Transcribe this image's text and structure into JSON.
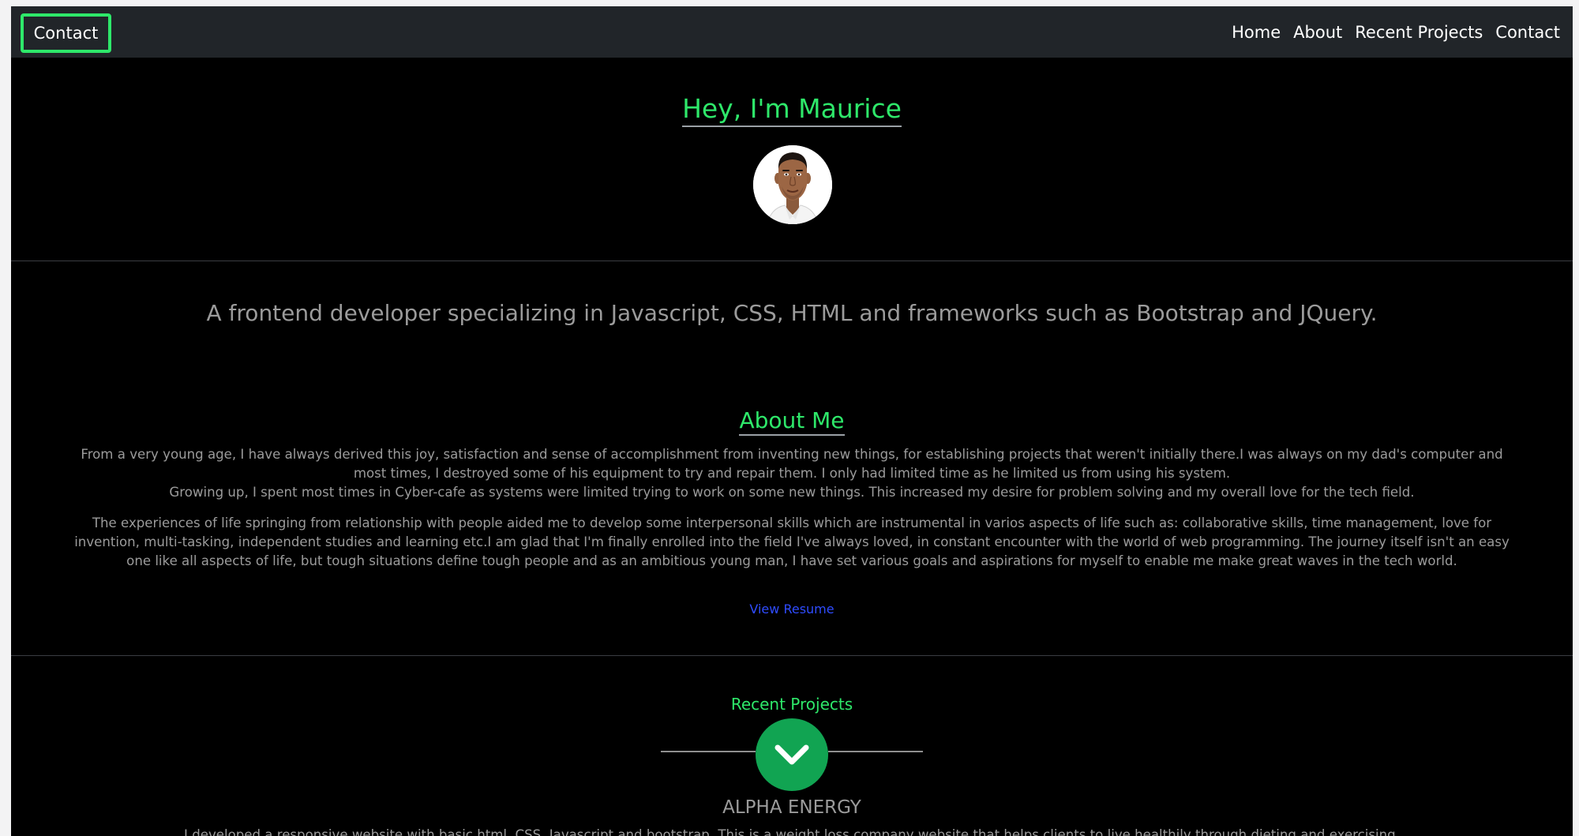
{
  "navbar": {
    "brand": "Contact",
    "links": [
      "Home",
      "About",
      "Recent Projects",
      "Contact"
    ]
  },
  "hero": {
    "title": "Hey, I'm Maurice",
    "avatar_alt": "profile avatar",
    "tagline": "A frontend developer specializing in Javascript, CSS, HTML and frameworks such as Bootstrap and JQuery."
  },
  "about": {
    "title": "About Me",
    "paragraph1": "From a very young age, I have always derived this joy, satisfaction and sense of accomplishment from inventing new things, for establishing projects that weren't initially there.I was always on my dad's computer and most times, I destroyed some of his equipment to try and repair them. I only had limited time as he limited us from using his system.",
    "paragraph1b": "Growing up, I spent most times in Cyber-cafe as systems were limited trying to work on some new things. This increased my desire for problem solving and my overall love for the tech field.",
    "paragraph2": "The experiences of life springing from relationship with people aided me to develop some interpersonal skills which are instrumental in varios aspects of life such as: collaborative skills, time management, love for invention, multi-tasking, independent studies and learning etc.I am glad that I'm finally enrolled into the field I've always loved, in constant encounter with the world of web programming. The journey itself isn't an easy one like all aspects of life, but tough situations define tough people and as an ambitious young man, I have set various goals and aspirations for myself to enable me make great waves in the tech world.",
    "resume_link": "View Resume"
  },
  "projects": {
    "title": "Recent Projects",
    "first_project_name": "ALPHA ENERGY",
    "first_project_desc": "I developed a responsive website with basic html, CSS, Javascript and bootstrap. This is a weight loss company website that helps clients to live healthily through dieting and exercising."
  },
  "colors": {
    "accent": "#2ee86a",
    "navbar_bg": "#212529",
    "page_bg": "#000000",
    "muted_text": "#9b9b9b",
    "link": "#2f4cff",
    "chevron_button": "#11a452"
  },
  "icons": {
    "chevron": "chevron-down-icon"
  }
}
